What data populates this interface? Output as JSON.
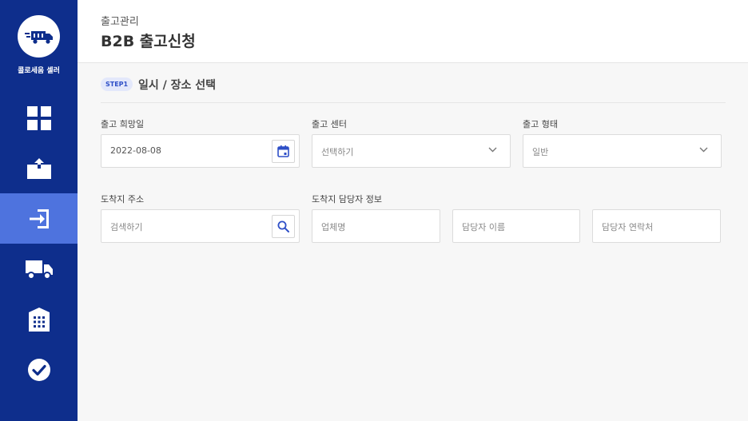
{
  "brand": {
    "name": "콜로세움 셀러",
    "logo_icon": "delivery-truck-logo"
  },
  "sidebar": {
    "items": [
      {
        "name": "dashboard",
        "icon": "grid-icon",
        "active": false
      },
      {
        "name": "inbound",
        "icon": "box-inbound-icon",
        "active": false
      },
      {
        "name": "outbound",
        "icon": "outbound-arrow-icon",
        "active": true
      },
      {
        "name": "delivery",
        "icon": "truck-icon",
        "active": false
      },
      {
        "name": "warehouse",
        "icon": "warehouse-icon",
        "active": false
      },
      {
        "name": "check",
        "icon": "check-circle-icon",
        "active": false
      }
    ],
    "bg_color": "#0e2e8c",
    "active_color": "#4e73de"
  },
  "header": {
    "breadcrumb": "출고관리",
    "title": "B2B 출고신청"
  },
  "step": {
    "badge": "STEP1",
    "title": "일시 / 장소 선택"
  },
  "form": {
    "date": {
      "label": "출고 희망일",
      "value": "2022-08-08"
    },
    "center": {
      "label": "출고 센터",
      "placeholder": "선택하기"
    },
    "type": {
      "label": "출고 형태",
      "value": "일반"
    },
    "address": {
      "label": "도착지 주소",
      "placeholder": "검색하기"
    },
    "contact": {
      "label": "도착지 담당자 정보",
      "company_placeholder": "업체명",
      "name_placeholder": "담당자 이름",
      "phone_placeholder": "담당자 연락처"
    }
  }
}
